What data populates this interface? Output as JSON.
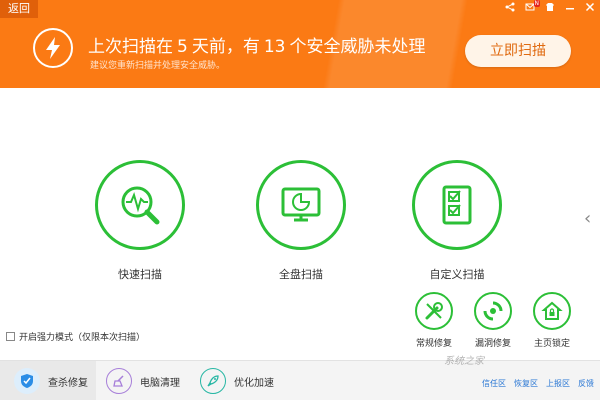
{
  "header": {
    "back_label": "返回",
    "headline_prefix": "上次扫描在",
    "days": "5",
    "headline_mid": "天前，有",
    "threats": "13",
    "headline_suffix": "个安全威胁未处理",
    "subline": "建议您重新扫描并处理安全威胁。",
    "scan_now_label": "立即扫描",
    "window_controls": [
      "share-icon",
      "mail-icon",
      "skin-icon",
      "minimize-icon",
      "close-icon"
    ],
    "mail_badge": "N"
  },
  "scan_options": [
    {
      "label": "快速扫描",
      "icon": "quick-scan-icon"
    },
    {
      "label": "全盘扫描",
      "icon": "full-scan-icon"
    },
    {
      "label": "自定义扫描",
      "icon": "custom-scan-icon"
    }
  ],
  "tools": [
    {
      "label": "常规修复",
      "icon": "repair-icon"
    },
    {
      "label": "漏洞修复",
      "icon": "vulnerability-fix-icon"
    },
    {
      "label": "主页锁定",
      "icon": "homepage-lock-icon"
    }
  ],
  "enhanced_mode": {
    "label": "开启强力模式（仅限本次扫描）",
    "checked": false
  },
  "bottom_nav": [
    {
      "label": "查杀修复",
      "icon": "shield-icon",
      "active": true,
      "color": "#2b8de6"
    },
    {
      "label": "电脑清理",
      "icon": "broom-icon",
      "active": false,
      "color": "#a77fd9"
    },
    {
      "label": "优化加速",
      "icon": "rocket-icon",
      "active": false,
      "color": "#27b7a4"
    }
  ],
  "bottom_links": [
    "信任区",
    "恢复区",
    "上报区",
    "反馈"
  ],
  "watermark": "系统之家",
  "colors": {
    "brand": "#fb7a14",
    "accent_green": "#2cbf37",
    "link": "#2a77d4"
  }
}
